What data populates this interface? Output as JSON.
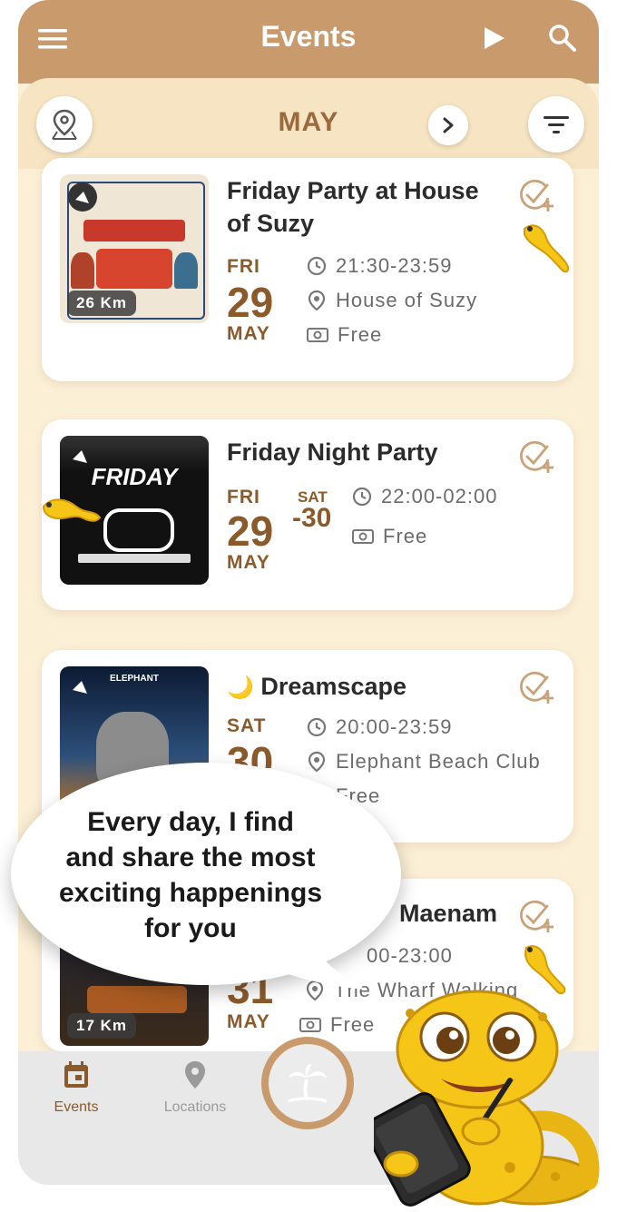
{
  "header": {
    "title": "Events"
  },
  "month_bar": {
    "month": "MAY"
  },
  "events": [
    {
      "title_line1": "Friday Party at House",
      "title_line2": "of Suzy",
      "distance": "26 Km",
      "day": "FRI",
      "date": "29",
      "month": "MAY",
      "time": "21:30-23:59",
      "location": "House of Suzy",
      "price": "Free"
    },
    {
      "title_line1": "Friday Night Party",
      "day": "FRI",
      "date": "29",
      "end_day": "SAT",
      "end_date": "-30",
      "month": "MAY",
      "time": "22:00-02:00",
      "price": "Free"
    },
    {
      "title_line1": "Dreamscape",
      "emoji": "🌙",
      "day": "SAT",
      "date": "30",
      "time": "20:00-23:59",
      "location": "Elephant Beach Club",
      "price": "Free"
    },
    {
      "title_line1": "Maenam",
      "distance": "17 Km",
      "date": "31",
      "month": "MAY",
      "time": "00-23:00",
      "location": "The Wharf Walking",
      "price": "Free"
    }
  ],
  "bubble": {
    "line1": "Every day, I find",
    "line2": "and share the most",
    "line3": "exciting happenings",
    "line4": "for you"
  },
  "nav": {
    "events": "Events",
    "locations": "Locations"
  },
  "colors": {
    "header": "#c99a6b",
    "background": "#fbefd6",
    "accent_brown": "#8b5a2b"
  },
  "icons": [
    "menu-icon",
    "play-icon",
    "search-icon",
    "map-pin-icon",
    "chevron-right-icon",
    "filter-icon",
    "clock-icon",
    "location-icon",
    "money-icon",
    "calendar-check-plus-icon",
    "gecko-icon",
    "calendar-icon",
    "palm-tree-icon"
  ]
}
